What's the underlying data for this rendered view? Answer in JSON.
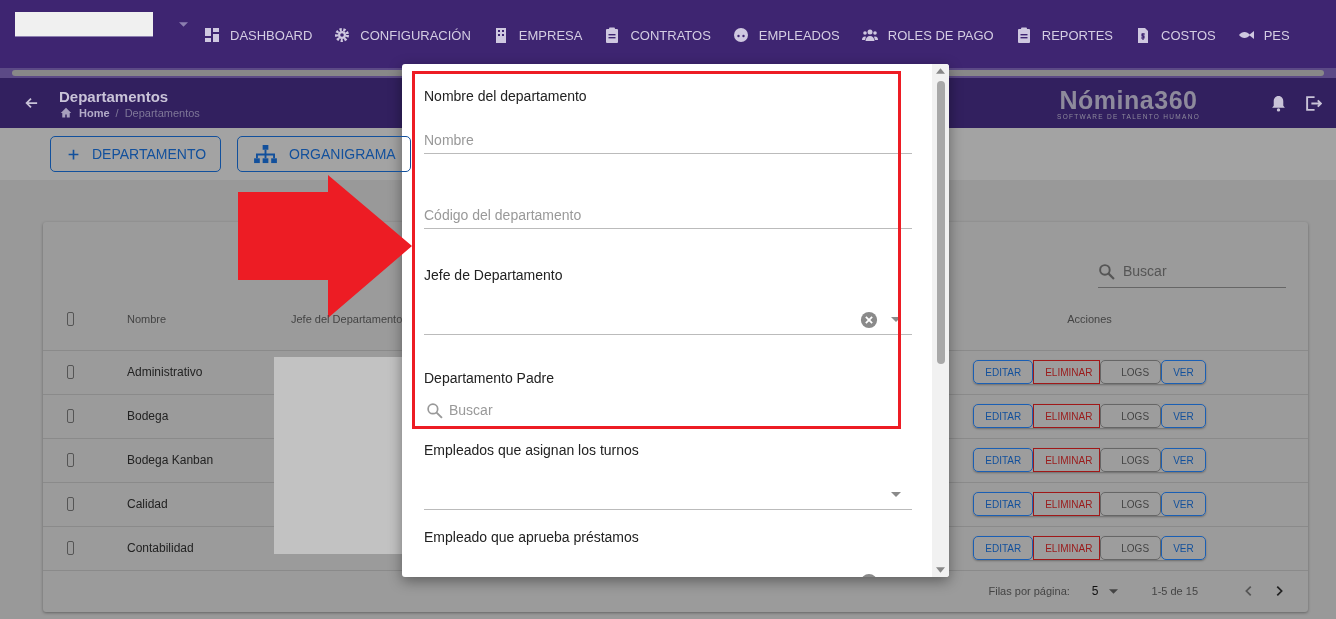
{
  "nav": {
    "items": [
      {
        "label": "DASHBOARD",
        "kind": "dashboard"
      },
      {
        "label": "CONFIGURACIÓN",
        "kind": "gear"
      },
      {
        "label": "EMPRESA",
        "kind": "building"
      },
      {
        "label": "CONTRATOS",
        "kind": "clipboard"
      },
      {
        "label": "EMPLEADOS",
        "kind": "face"
      },
      {
        "label": "ROLES DE PAGO",
        "kind": "people"
      },
      {
        "label": "REPORTES",
        "kind": "clipboard"
      },
      {
        "label": "COSTOS",
        "kind": "dollar"
      },
      {
        "label": "PES",
        "kind": "fish"
      }
    ]
  },
  "header": {
    "title": "Departamentos",
    "breadcrumbs": [
      "Home",
      "Departamentos"
    ],
    "breadcrumb_separator": "/",
    "logo": "Nómina360",
    "tagline": "SOFTWARE DE TALENTO HUMANO"
  },
  "toolbar": {
    "buttons": [
      {
        "label": "DEPARTAMENTO",
        "kind": "add"
      },
      {
        "label": "ORGANIGRAMA",
        "kind": "org"
      }
    ]
  },
  "table": {
    "search": {
      "placeholder": "Buscar"
    },
    "header_checked": false,
    "columns": [
      "Nombre",
      "Jefe del Departamento",
      "Acciones"
    ],
    "rows": [
      {
        "checked": false,
        "name": "Administrativo",
        "actions": [
          {
            "label": "EDITAR",
            "kind": "edit"
          },
          {
            "label": "ELIMINAR",
            "kind": "delete"
          },
          {
            "label": "LOGS",
            "kind": "logs"
          },
          {
            "label": "VER",
            "kind": "view"
          }
        ]
      },
      {
        "checked": false,
        "name": "Bodega",
        "actions": [
          {
            "label": "EDITAR",
            "kind": "edit"
          },
          {
            "label": "ELIMINAR",
            "kind": "delete"
          },
          {
            "label": "LOGS",
            "kind": "logs"
          },
          {
            "label": "VER",
            "kind": "view"
          }
        ]
      },
      {
        "checked": false,
        "name": "Bodega Kanban",
        "actions": [
          {
            "label": "EDITAR",
            "kind": "edit"
          },
          {
            "label": "ELIMINAR",
            "kind": "delete"
          },
          {
            "label": "LOGS",
            "kind": "logs"
          },
          {
            "label": "VER",
            "kind": "view"
          }
        ]
      },
      {
        "checked": false,
        "name": "Calidad",
        "actions": [
          {
            "label": "EDITAR",
            "kind": "edit"
          },
          {
            "label": "ELIMINAR",
            "kind": "delete"
          },
          {
            "label": "LOGS",
            "kind": "logs"
          },
          {
            "label": "VER",
            "kind": "view"
          }
        ]
      },
      {
        "checked": false,
        "name": "Contabilidad",
        "actions": [
          {
            "label": "EDITAR",
            "kind": "edit"
          },
          {
            "label": "ELIMINAR",
            "kind": "delete"
          },
          {
            "label": "LOGS",
            "kind": "logs"
          },
          {
            "label": "VER",
            "kind": "view"
          }
        ]
      }
    ],
    "footer": {
      "rows_per_page_label": "Filas por página:",
      "rows_per_page": "5",
      "range": "1-5 de 15"
    }
  },
  "dialog": {
    "fields": [
      {
        "kind": "text",
        "label": "Nombre del departamento",
        "placeholder": "Nombre"
      },
      {
        "kind": "text",
        "placeholder": "Código del departamento"
      },
      {
        "kind": "select",
        "label": "Jefe de Departamento",
        "clearable": true
      },
      {
        "kind": "search",
        "label": "Departamento Padre",
        "placeholder": "Buscar"
      },
      {
        "kind": "select",
        "label": "Empleados que asignan los turnos",
        "clearable": false
      },
      {
        "kind": "select",
        "label": "Empleado que aprueba préstamos",
        "clearable": true
      }
    ]
  }
}
